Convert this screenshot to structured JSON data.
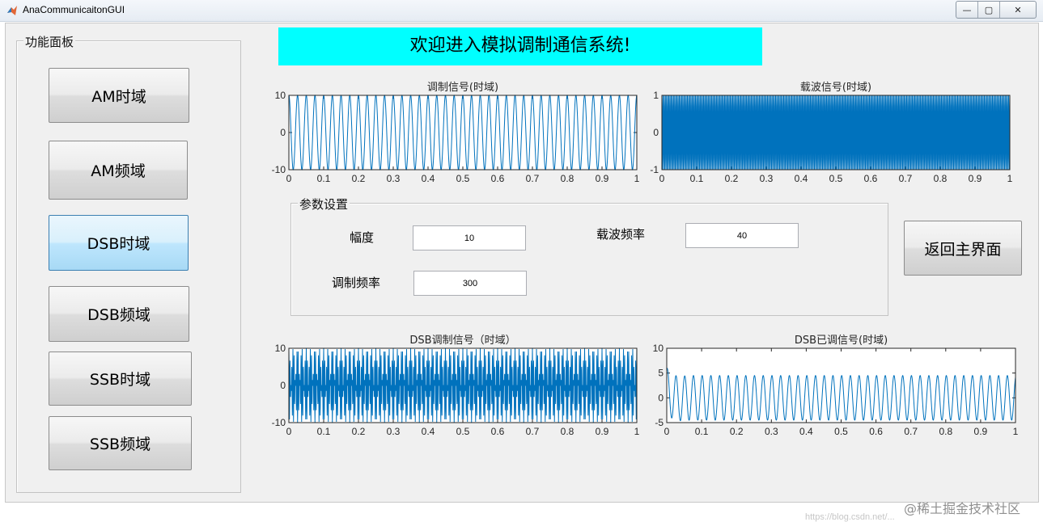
{
  "window": {
    "title": "AnaCommunicaitonGUI",
    "controls": [
      "—",
      "▢",
      "✕"
    ]
  },
  "banner": {
    "text": "欢迎进入模拟调制通信系统!"
  },
  "sidebar": {
    "title": "功能面板",
    "buttons": [
      {
        "label": "AM时域",
        "active": false
      },
      {
        "label": "AM频域",
        "active": false
      },
      {
        "label": "DSB时域",
        "active": true
      },
      {
        "label": "DSB频域",
        "active": false
      },
      {
        "label": "SSB时域",
        "active": false
      },
      {
        "label": "SSB频域",
        "active": false
      }
    ]
  },
  "params": {
    "title": "参数设置",
    "amplitude": {
      "label": "幅度",
      "value": "10"
    },
    "carrier_freq": {
      "label": "载波频率",
      "value": "40"
    },
    "mod_freq": {
      "label": "调制频率",
      "value": "300"
    }
  },
  "back_button": {
    "label": "返回主界面"
  },
  "watermark": {
    "main": "@稀土掘金技术社区",
    "url": "https://blog.csdn.net/..."
  },
  "colors": {
    "banner": "#00ffff",
    "line": "#0072bd",
    "active_button": "#bee6fd"
  },
  "chart_data": [
    {
      "type": "line",
      "title": "调制信号(时域)",
      "xlim": [
        0,
        1
      ],
      "ylim": [
        -10,
        10
      ],
      "xticks": [
        "0",
        "0.1",
        "0.2",
        "0.3",
        "0.4",
        "0.5",
        "0.6",
        "0.7",
        "0.8",
        "0.9",
        "1"
      ],
      "yticks": [
        "10",
        "0",
        "-10"
      ],
      "series": [
        {
          "amplitude": 10,
          "frequency": 40
        }
      ]
    },
    {
      "type": "line",
      "title": "载波信号(时域)",
      "xlim": [
        0,
        1
      ],
      "ylim": [
        -1,
        1
      ],
      "xticks": [
        "0",
        "0.1",
        "0.2",
        "0.3",
        "0.4",
        "0.5",
        "0.6",
        "0.7",
        "0.8",
        "0.9",
        "1"
      ],
      "yticks": [
        "1",
        "0",
        "-1"
      ],
      "series": [
        {
          "amplitude": 1,
          "frequency": 300
        }
      ]
    },
    {
      "type": "line",
      "title": "DSB调制信号（时域）",
      "xlim": [
        0,
        1
      ],
      "ylim": [
        -10,
        10
      ],
      "xticks": [
        "0",
        "0.1",
        "0.2",
        "0.3",
        "0.4",
        "0.5",
        "0.6",
        "0.7",
        "0.8",
        "0.9",
        "1"
      ],
      "yticks": [
        "10",
        "0",
        "-10"
      ],
      "series": [
        {
          "amplitude": 10,
          "frequency": 40,
          "carrier_frequency": 300
        }
      ]
    },
    {
      "type": "line",
      "title": "DSB已调信号(时域)",
      "xlim": [
        0,
        1
      ],
      "ylim": [
        -5,
        10
      ],
      "xticks": [
        "0",
        "0.1",
        "0.2",
        "0.3",
        "0.4",
        "0.5",
        "0.6",
        "0.7",
        "0.8",
        "0.9",
        "1"
      ],
      "yticks": [
        "10",
        "5",
        "0",
        "-5"
      ],
      "series": [
        {
          "amplitude": 4.5,
          "frequency": 40,
          "offset": 0
        }
      ]
    }
  ]
}
